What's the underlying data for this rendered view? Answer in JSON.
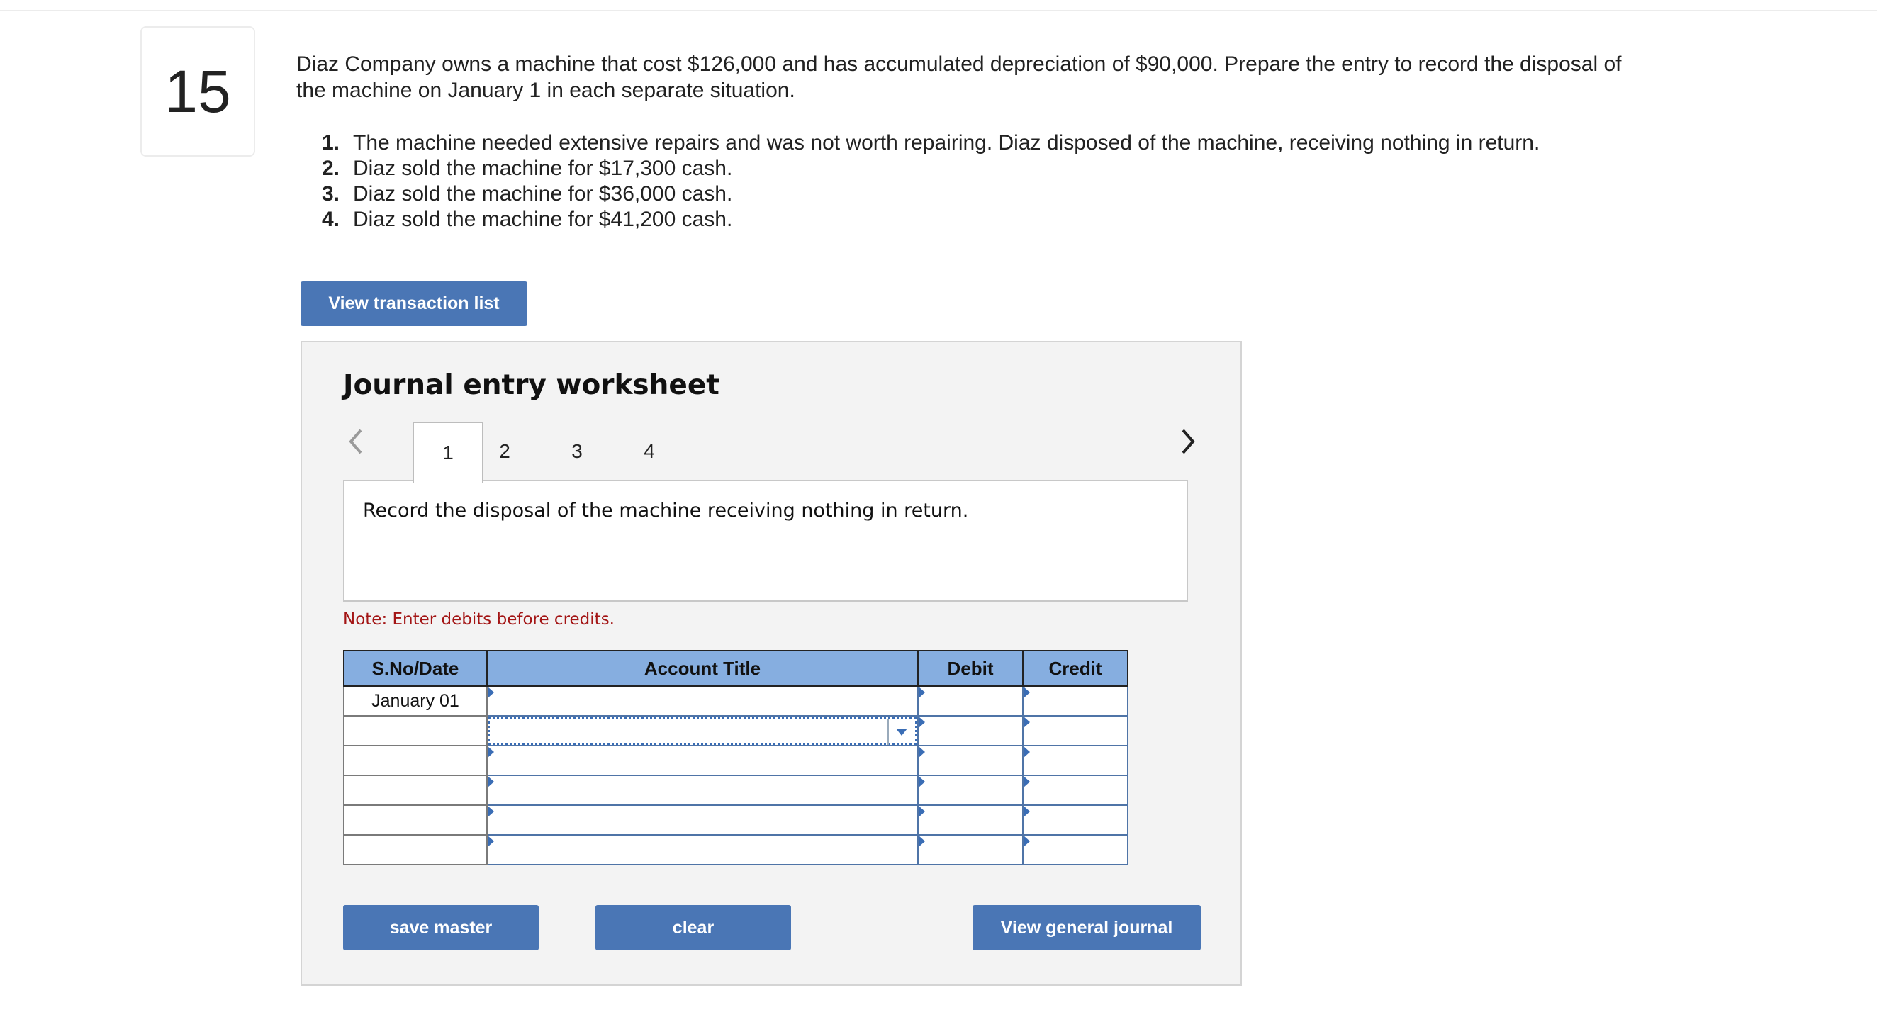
{
  "question": {
    "number": "15",
    "prompt": "Diaz Company owns a machine that cost $126,000 and has accumulated depreciation of $90,000. Prepare the entry to record the disposal of the machine on January 1 in each separate situation.",
    "situations": [
      {
        "num": "1.",
        "text": "The machine needed extensive repairs and was not worth repairing. Diaz disposed of the machine, receiving nothing in return."
      },
      {
        "num": "2.",
        "text": "Diaz sold the machine for $17,300 cash."
      },
      {
        "num": "3.",
        "text": "Diaz sold the machine for $36,000 cash."
      },
      {
        "num": "4.",
        "text": "Diaz sold the machine for $41,200 cash."
      }
    ]
  },
  "buttons": {
    "view_transaction_list": "View transaction list",
    "save_master": "save master",
    "clear": "clear",
    "view_general_journal": "View general journal"
  },
  "worksheet": {
    "title": "Journal entry worksheet",
    "tabs": [
      "1",
      "2",
      "3",
      "4"
    ],
    "active_tab": "1",
    "instruction": "Record the disposal of the machine receiving nothing in return.",
    "note": "Note: Enter debits before credits.",
    "columns": [
      "S.No/Date",
      "Account Title",
      "Debit",
      "Credit"
    ],
    "rows": [
      {
        "date": "January 01",
        "account": "",
        "debit": "",
        "credit": ""
      },
      {
        "date": "",
        "account": "",
        "debit": "",
        "credit": ""
      },
      {
        "date": "",
        "account": "",
        "debit": "",
        "credit": ""
      },
      {
        "date": "",
        "account": "",
        "debit": "",
        "credit": ""
      },
      {
        "date": "",
        "account": "",
        "debit": "",
        "credit": ""
      },
      {
        "date": "",
        "account": "",
        "debit": "",
        "credit": ""
      }
    ]
  },
  "colors": {
    "button": "#4a76b5",
    "table_header": "#86aee0",
    "note_text": "#a31515",
    "worksheet_bg": "#f3f3f3"
  },
  "icons": {
    "prev": "chevron-left-icon",
    "next": "chevron-right-icon",
    "dropdown": "caret-down-icon"
  }
}
